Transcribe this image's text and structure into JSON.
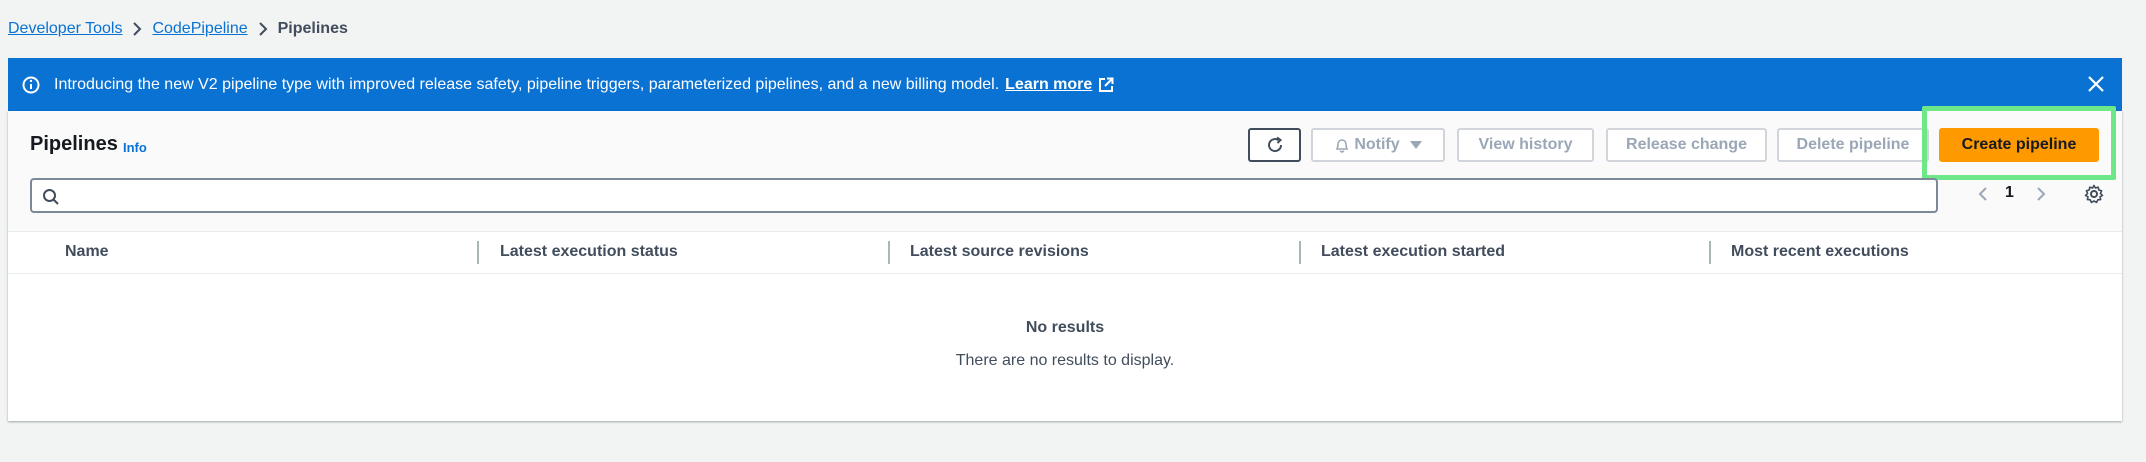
{
  "breadcrumb": {
    "items": [
      "Developer Tools",
      "CodePipeline"
    ],
    "current": "Pipelines"
  },
  "banner": {
    "text": "Introducing the new V2 pipeline type with improved release safety, pipeline triggers, parameterized pipelines, and a new billing model.",
    "link": "Learn more",
    "background": "#0972d3"
  },
  "header": {
    "title": "Pipelines",
    "info": "Info"
  },
  "actions": {
    "notify": "Notify",
    "view_history": "View history",
    "release_change": "Release change",
    "delete_pipeline": "Delete pipeline",
    "create_pipeline": "Create pipeline",
    "primary_color": "#ff9900"
  },
  "search": {
    "value": "",
    "placeholder": ""
  },
  "pagination": {
    "current_page": "1"
  },
  "table": {
    "columns": [
      "Name",
      "Latest execution status",
      "Latest source revisions",
      "Latest execution started",
      "Most recent executions"
    ],
    "empty_title": "No results",
    "empty_description": "There are no results to display."
  },
  "icons": {
    "info": "info-circle-icon",
    "external": "external-link-icon",
    "close": "close-icon",
    "refresh": "refresh-icon",
    "bell": "bell-icon",
    "caret": "caret-down-icon",
    "search": "search-icon",
    "prev": "chevron-left-icon",
    "next": "chevron-right-icon",
    "settings": "gear-icon"
  }
}
